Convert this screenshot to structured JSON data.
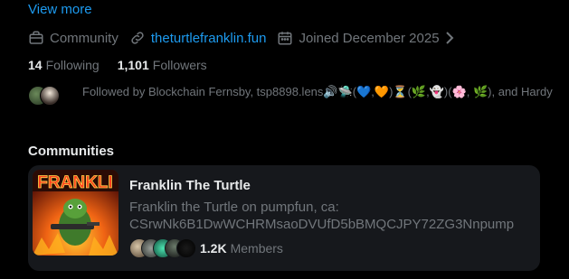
{
  "profile": {
    "view_more": "View more",
    "category": "Community",
    "website": "theturtlefranklin.fun",
    "joined": "Joined December 2025",
    "following_count": "14",
    "following_label": "Following",
    "followers_count": "1,101",
    "followers_label": "Followers",
    "followed_by_text": "Followed by Blockchain Fernsby, tsp8898.lens🔊🛸(💙,🧡)⏳(🌿,👻)(🌸, 🌿), and Hardy"
  },
  "communities": {
    "section_title": "Communities",
    "items": [
      {
        "thumb_text": "FRANKLI",
        "name": "Franklin The Turtle",
        "description": "Franklin the Turtle on pumpfun, ca: CSrwNk6B1DwWCHRMsaoDVUfD5bBMQCJPY72ZG3Nnpump",
        "members_count": "1.2K",
        "members_label": "Members"
      }
    ]
  },
  "colors": {
    "background": "#000000",
    "accent": "#1d9bf0",
    "secondary_text": "#71767b",
    "card": "#16181c"
  },
  "icons": [
    "briefcase-icon",
    "link-icon",
    "calendar-icon",
    "chevron-right-icon"
  ]
}
